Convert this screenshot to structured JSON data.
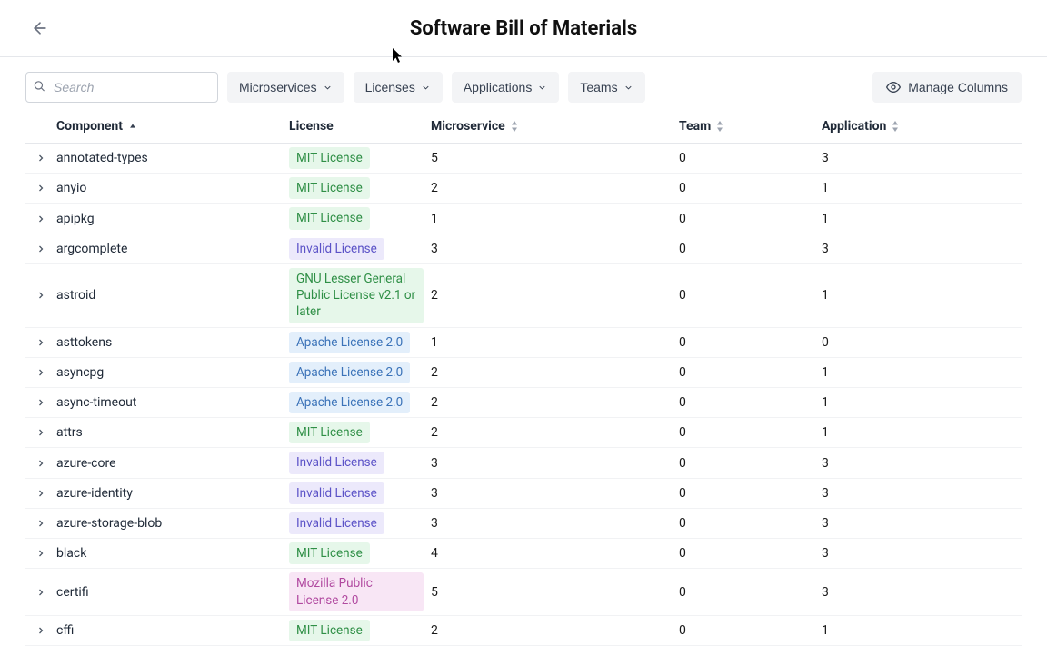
{
  "header": {
    "title": "Software Bill of Materials"
  },
  "search": {
    "placeholder": "Search"
  },
  "filters": [
    {
      "label": "Microservices"
    },
    {
      "label": "Licenses"
    },
    {
      "label": "Applications"
    },
    {
      "label": "Teams"
    }
  ],
  "manage_columns_label": "Manage Columns",
  "columns": {
    "component": "Component",
    "license": "License",
    "microservice": "Microservice",
    "team": "Team",
    "application": "Application"
  },
  "license_styles": {
    "MIT License": "lic-green",
    "Invalid License": "lic-purple",
    "GNU Lesser General Public License v2.1 or later": "lic-green",
    "Apache License 2.0": "lic-blue",
    "Mozilla Public License 2.0": "lic-pink"
  },
  "rows": [
    {
      "component": "annotated-types",
      "license": "MIT License",
      "microservice": "5",
      "team": "0",
      "application": "3"
    },
    {
      "component": "anyio",
      "license": "MIT License",
      "microservice": "2",
      "team": "0",
      "application": "1"
    },
    {
      "component": "apipkg",
      "license": "MIT License",
      "microservice": "1",
      "team": "0",
      "application": "1"
    },
    {
      "component": "argcomplete",
      "license": "Invalid License",
      "microservice": "3",
      "team": "0",
      "application": "3"
    },
    {
      "component": "astroid",
      "license": "GNU Lesser General Public License v2.1 or later",
      "microservice": "2",
      "team": "0",
      "application": "1"
    },
    {
      "component": "asttokens",
      "license": "Apache License 2.0",
      "microservice": "1",
      "team": "0",
      "application": "0"
    },
    {
      "component": "asyncpg",
      "license": "Apache License 2.0",
      "microservice": "2",
      "team": "0",
      "application": "1"
    },
    {
      "component": "async-timeout",
      "license": "Apache License 2.0",
      "microservice": "2",
      "team": "0",
      "application": "1"
    },
    {
      "component": "attrs",
      "license": "MIT License",
      "microservice": "2",
      "team": "0",
      "application": "1"
    },
    {
      "component": "azure-core",
      "license": "Invalid License",
      "microservice": "3",
      "team": "0",
      "application": "3"
    },
    {
      "component": "azure-identity",
      "license": "Invalid License",
      "microservice": "3",
      "team": "0",
      "application": "3"
    },
    {
      "component": "azure-storage-blob",
      "license": "Invalid License",
      "microservice": "3",
      "team": "0",
      "application": "3"
    },
    {
      "component": "black",
      "license": "MIT License",
      "microservice": "4",
      "team": "0",
      "application": "3"
    },
    {
      "component": "certifi",
      "license": "Mozilla Public License 2.0",
      "microservice": "5",
      "team": "0",
      "application": "3"
    },
    {
      "component": "cffi",
      "license": "MIT License",
      "microservice": "2",
      "team": "0",
      "application": "1"
    }
  ]
}
